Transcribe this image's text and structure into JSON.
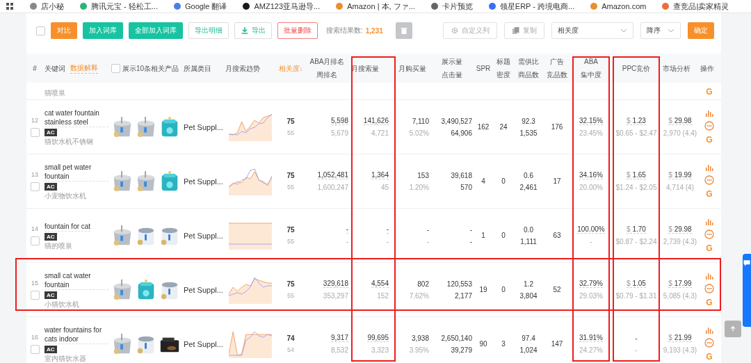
{
  "bookmarks": [
    {
      "label": "店小秘"
    },
    {
      "label": "腾讯元宝 - 轻松工..."
    },
    {
      "label": "Google 翻译"
    },
    {
      "label": "AMZ123亚马逊导..."
    },
    {
      "label": "Amazon | 本, ファ..."
    },
    {
      "label": "卡片预览"
    },
    {
      "label": "领星ERP - 跨境电商..."
    },
    {
      "label": "Amazon.com"
    },
    {
      "label": "查竞品|卖家精灵"
    }
  ],
  "toolbar": {
    "select_all": {
      "checked": false
    },
    "buttons": [
      {
        "kind": "orange",
        "label": "对比"
      },
      {
        "kind": "green",
        "label": "加入词库"
      },
      {
        "kind": "green",
        "label": "全部加入词库"
      },
      {
        "kind": "outline",
        "label": "导出明细"
      },
      {
        "kind": "outline",
        "label": "导出"
      },
      {
        "kind": "danger",
        "label": "批量删除"
      }
    ],
    "result_label": "搜索结果数:",
    "result_count": "1,231",
    "right": [
      {
        "kind": "trash"
      },
      {
        "kind": "ghost",
        "label": "自定义列"
      },
      {
        "kind": "ghost",
        "label": "复制"
      },
      {
        "kind": "select",
        "label": "相关度"
      },
      {
        "kind": "select",
        "label": "降序"
      },
      {
        "kind": "orange",
        "label": "确定"
      }
    ]
  },
  "columns": [
    {
      "lines": [
        "#"
      ]
    },
    {
      "lines": [
        "关键词"
      ],
      "link": "数据解释"
    },
    {
      "lines": [
        "展示10条相关产品"
      ],
      "checked": false
    },
    {
      "lines": [
        "所属类目"
      ]
    },
    {
      "lines": [
        "月搜索趋势"
      ]
    },
    {
      "lines": [
        "相关度↓"
      ],
      "sorted": true
    },
    {
      "lines": [
        "ABA月排名",
        "周排名"
      ]
    },
    {
      "lines": [
        "月搜索量"
      ],
      "highlighted": true
    },
    {
      "lines": [
        "月购买量"
      ]
    },
    {
      "lines": [
        "展示量",
        "点击量"
      ]
    },
    {
      "lines": [
        "SPR"
      ]
    },
    {
      "lines": [
        "标题",
        "密度"
      ]
    },
    {
      "lines": [
        "需供比",
        "商品数"
      ]
    },
    {
      "lines": [
        "广告",
        "竞品数"
      ]
    },
    {
      "lines": [
        "ABA",
        "集中度"
      ],
      "highlighted": true
    },
    {
      "lines": [
        "PPC竞价"
      ],
      "highlighted": true
    },
    {
      "lines": [
        "市场分析"
      ]
    },
    {
      "lines": [
        "操作"
      ]
    }
  ],
  "rows": [
    {
      "kind": "partial",
      "keyword_cn": "猫喷泉",
      "action_label": "G"
    },
    {
      "kind": "full",
      "number": "12",
      "checked": false,
      "keyword": "cat water fountain stainless steel",
      "tag": "AC",
      "keyword_cn": "猫饮水机不锈钢",
      "images": [
        {
          "kind": "picture"
        },
        {
          "kind": "picture"
        },
        {
          "kind": "picture"
        }
      ],
      "category": "Pet Suppl...",
      "relevance": [
        "75",
        "55"
      ],
      "aba_rank": [
        "5,598",
        "5,679"
      ],
      "search_volume": [
        "141,626",
        "4,721"
      ],
      "purchases": [
        "7,110",
        "5.02%"
      ],
      "impressions_clicks": [
        "3,490,527",
        "64,906"
      ],
      "spr": "162",
      "title_density": "24",
      "supply_demand": [
        "92.3",
        "1,535"
      ],
      "ad_products": "176",
      "aba_concentration": [
        "32.15%",
        "23.45%"
      ],
      "ppc": {
        "currency": "$",
        "bid": "1.23",
        "range": "$0.65 - $2.47"
      },
      "market": {
        "currency": "$",
        "price": "29.98",
        "reviews": "2,970 (4.4)"
      },
      "action_label": "G",
      "highlighted": false
    },
    {
      "kind": "full",
      "number": "13",
      "checked": false,
      "keyword": "small pet water fountain",
      "tag": "AC",
      "keyword_cn": "小宠物饮水机",
      "images": [
        {
          "kind": "picture"
        },
        {
          "kind": "picture"
        },
        {
          "kind": "picture"
        }
      ],
      "category": "Pet Suppl...",
      "relevance": [
        "75",
        "55"
      ],
      "aba_rank": [
        "1,052,481",
        "1,600,247"
      ],
      "search_volume": [
        "1,364",
        "45"
      ],
      "purchases": [
        "153",
        "1.20%"
      ],
      "impressions_clicks": [
        "39,618",
        "570"
      ],
      "spr": "4",
      "title_density": "0",
      "supply_demand": [
        "0.6",
        "2,461"
      ],
      "ad_products": "17",
      "aba_concentration": [
        "34.16%",
        "20.00%"
      ],
      "ppc": {
        "currency": "$",
        "bid": "1.65",
        "range": "$1.24 - $2.05"
      },
      "market": {
        "currency": "$",
        "price": "19.99",
        "reviews": "4,714 (4)"
      },
      "action_label": "G",
      "highlighted": false
    },
    {
      "kind": "full",
      "number": "14",
      "checked": false,
      "keyword": "fountain for cat",
      "tag": "AC",
      "keyword_cn": "猫的喷泉",
      "images": [
        {
          "kind": "picture"
        },
        {
          "kind": "picture"
        },
        {
          "kind": "picture"
        }
      ],
      "category": "Pet Suppl...",
      "relevance": [
        "75",
        "55"
      ],
      "aba_rank": [
        "-",
        "-"
      ],
      "search_volume": [
        "-",
        "-"
      ],
      "purchases": [
        "-",
        "-"
      ],
      "impressions_clicks": [
        "-",
        "-"
      ],
      "spr": "1",
      "title_density": "0",
      "supply_demand": [
        "0.0",
        "1,111"
      ],
      "ad_products": "63",
      "aba_concentration": [
        "100.00%",
        "-"
      ],
      "ppc": {
        "currency": "$",
        "bid": "1.70",
        "range": "$0.87 - $2.24"
      },
      "market": {
        "currency": "$",
        "price": "29.98",
        "reviews": "2,739 (4.3)"
      },
      "action_label": "G",
      "highlighted": false
    },
    {
      "kind": "full",
      "number": "15",
      "checked": false,
      "keyword": "small cat water fountain",
      "tag": "AC",
      "keyword_cn": "小猫饮水机",
      "images": [
        {
          "kind": "picture"
        },
        {
          "kind": "picture"
        },
        {
          "kind": "picture"
        }
      ],
      "category": "Pet Suppl...",
      "relevance": [
        "75",
        "55"
      ],
      "aba_rank": [
        "329,618",
        "353,297"
      ],
      "search_volume": [
        "4,554",
        "152"
      ],
      "purchases": [
        "802",
        "7.62%"
      ],
      "impressions_clicks": [
        "120,553",
        "2,177"
      ],
      "spr": "19",
      "title_density": "0",
      "supply_demand": [
        "1.2",
        "3,804"
      ],
      "ad_products": "52",
      "aba_concentration": [
        "32.79%",
        "29.03%"
      ],
      "ppc": {
        "currency": "$",
        "bid": "1.05",
        "range": "$0.79 - $1.31"
      },
      "market": {
        "currency": "$",
        "price": "17.99",
        "reviews": "5,085 (4.3)"
      },
      "action_label": "G",
      "highlighted": true
    },
    {
      "kind": "full",
      "number": "16",
      "checked": false,
      "keyword": "water fountains for cats indoor",
      "tag": "AC",
      "keyword_cn": "室内猫饮水器",
      "images": [
        {
          "kind": "picture"
        },
        {
          "kind": "picture"
        },
        {
          "kind": "picture"
        }
      ],
      "category": "Pet Suppl...",
      "relevance": [
        "74",
        "54"
      ],
      "aba_rank": [
        "9,317",
        "8,532"
      ],
      "search_volume": [
        "99,695",
        "3,323"
      ],
      "purchases": [
        "3,938",
        "3.95%"
      ],
      "impressions_clicks": [
        "2,650,140",
        "39,279"
      ],
      "spr": "90",
      "title_density": "3",
      "supply_demand": [
        "97.4",
        "1,024"
      ],
      "ad_products": "147",
      "aba_concentration": [
        "31.91%",
        "24.27%"
      ],
      "ppc": {
        "bid": "-",
        "range": "-"
      },
      "market": {
        "currency": "$",
        "price": "21.99",
        "reviews": "9,193 (4.3)"
      },
      "action_label": "G",
      "highlighted": false
    }
  ]
}
